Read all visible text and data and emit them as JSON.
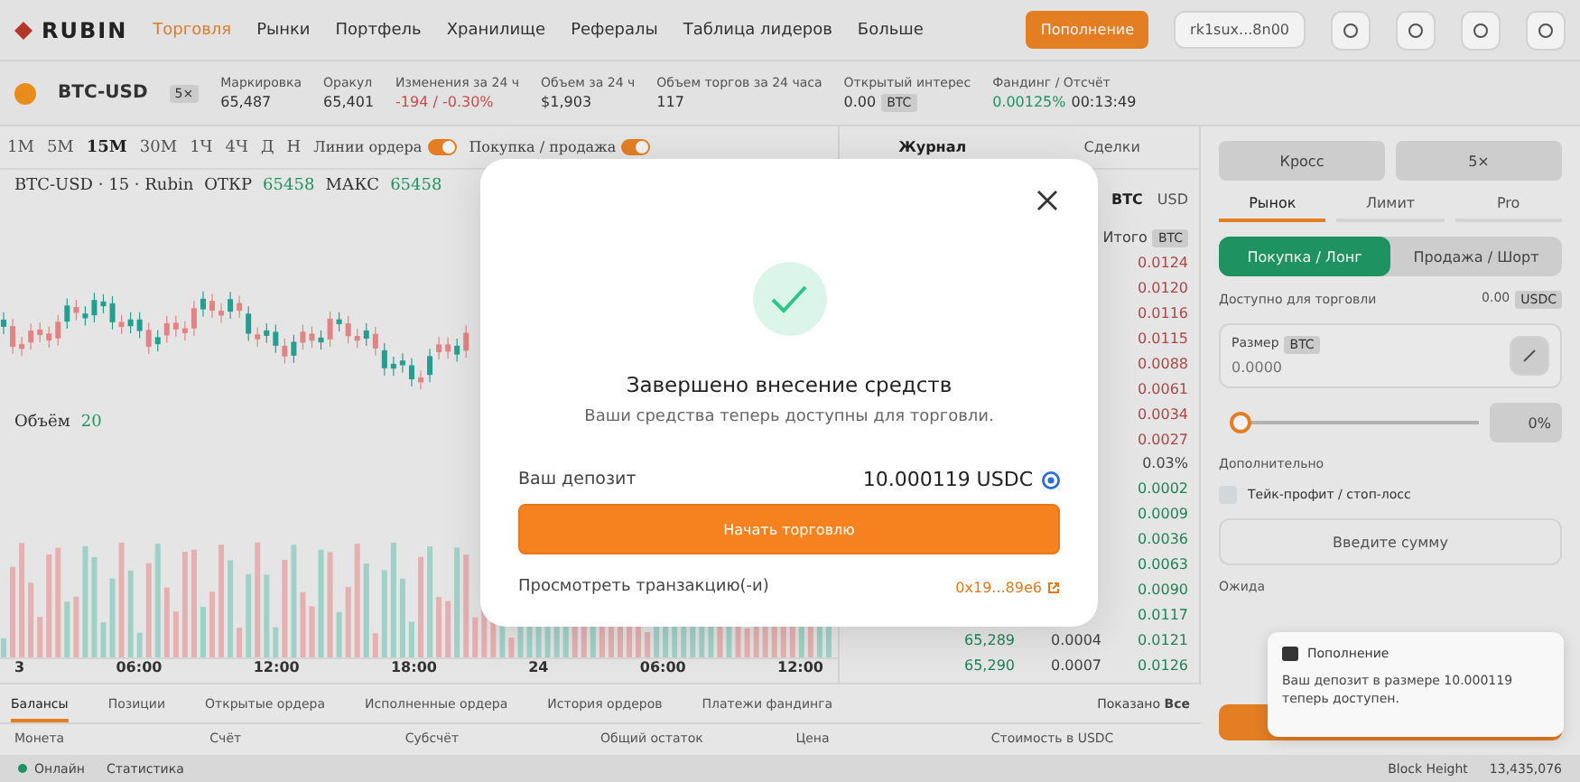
{
  "header": {
    "logo": "RUBIN",
    "nav": [
      {
        "label": "Торговля",
        "selected": true
      },
      {
        "label": "Рынки",
        "selected": false
      },
      {
        "label": "Портфель",
        "selected": false
      },
      {
        "label": "Хранилище",
        "selected": false
      },
      {
        "label": "Рефералы",
        "selected": false
      },
      {
        "label": "Таблица лидеров",
        "selected": false
      },
      {
        "label": "Больше",
        "selected": false
      }
    ],
    "deposit_button": "Пополнение",
    "wallet": "rk1sux...8n00"
  },
  "ticker": {
    "market": "BTC-USD",
    "leverage": "5×",
    "stats": [
      {
        "label": "Маркировка",
        "value": "65,487"
      },
      {
        "label": "Оракул",
        "value": "65,401"
      },
      {
        "label": "Изменения за 24 ч",
        "value": "-194 / -0.30%",
        "color": "#d84c4c"
      },
      {
        "label": "Объем за 24 ч",
        "value": "$1,903"
      },
      {
        "label": "Объем торгов за 24 часа",
        "value": "117"
      },
      {
        "label": "Открытый интерес",
        "value": "0.00",
        "unit": "BTC"
      },
      {
        "label": "Фандинг / Отсчёт",
        "value": "0.00125%",
        "color": "#1f9a66",
        "extra": "00:13:49"
      }
    ]
  },
  "chart": {
    "timeframes": [
      {
        "label": "1М",
        "selected": false
      },
      {
        "label": "5М",
        "selected": false
      },
      {
        "label": "15М",
        "selected": true
      },
      {
        "label": "30М",
        "selected": false
      },
      {
        "label": "1Ч",
        "selected": false
      },
      {
        "label": "4Ч",
        "selected": false
      },
      {
        "label": "Д",
        "selected": false
      },
      {
        "label": "Н",
        "selected": false
      }
    ],
    "toggles": [
      {
        "label": "Линии ордера",
        "on": true
      },
      {
        "label": "Покупка / продажа",
        "on": true
      }
    ],
    "legend": {
      "title": "BTC-USD · 15 · Rubin",
      "open_label": "ОТКР",
      "open": "65458",
      "high_label": "МАКС",
      "high": "65458"
    },
    "volume_label": "Объём",
    "volume": "20",
    "time_axis": [
      "3",
      "06:00",
      "12:00",
      "18:00",
      "24",
      "06:00",
      "12:00"
    ]
  },
  "orderbook": {
    "tabs": [
      {
        "label": "Журнал",
        "selected": true
      },
      {
        "label": "Сделки",
        "selected": false
      }
    ],
    "units": [
      {
        "label": "BTC",
        "selected": true
      },
      {
        "label": "USD",
        "selected": false
      }
    ],
    "total_label": "Итого",
    "total_unit": "BTC",
    "spread": "0.03%",
    "rows": [
      {
        "kind": "ask",
        "total": "0.0124"
      },
      {
        "kind": "ask",
        "total": "0.0120"
      },
      {
        "kind": "ask",
        "total": "0.0116"
      },
      {
        "kind": "ask",
        "total": "0.0115"
      },
      {
        "kind": "ask",
        "total": "0.0088"
      },
      {
        "kind": "ask",
        "total": "0.0061"
      },
      {
        "kind": "ask",
        "total": "0.0034"
      },
      {
        "kind": "ask",
        "total": "0.0027"
      },
      {
        "kind": "spread"
      },
      {
        "kind": "bid",
        "total": "0.0002"
      },
      {
        "kind": "bid",
        "total": "0.0009"
      },
      {
        "kind": "bid",
        "total": "0.0036"
      },
      {
        "kind": "bid",
        "total": "0.0063"
      },
      {
        "kind": "bid",
        "total": "0.0090"
      },
      {
        "kind": "bid",
        "total": "0.0117"
      },
      {
        "kind": "bid",
        "price": "65,289",
        "size": "0.0004",
        "total": "0.0121"
      },
      {
        "kind": "bid",
        "price": "65,290",
        "size": "0.0007",
        "total": "0.0126"
      }
    ]
  },
  "order_panel": {
    "margin": [
      "Кросс",
      "5×"
    ],
    "tabs": [
      {
        "label": "Рынок",
        "selected": true
      },
      {
        "label": "Лимит",
        "selected": false
      },
      {
        "label": "Pro",
        "selected": false
      }
    ],
    "sides": [
      {
        "label": "Покупка / Лонг",
        "selected": true
      },
      {
        "label": "Продажа / Шорт",
        "selected": false
      }
    ],
    "available_label": "Доступно для торговли",
    "available": "0.00",
    "available_unit": "USDC",
    "size_label": "Размер",
    "size_unit": "BTC",
    "size_placeholder": "0.0000",
    "slider": {
      "level": 0,
      "reading": "0%"
    },
    "extra_label": "Дополнительно",
    "tpsl": {
      "label": "Тейк-профит / стоп-лосс",
      "checked": false
    },
    "amount_placeholder": "Введите сумму",
    "pending_label": "Ожида"
  },
  "bottom": {
    "tabs": [
      {
        "label": "Балансы",
        "selected": true
      },
      {
        "label": "Позиции",
        "selected": false
      },
      {
        "label": "Открытые ордера",
        "selected": false
      },
      {
        "label": "Исполненные ордера",
        "selected": false
      },
      {
        "label": "История ордеров",
        "selected": false
      },
      {
        "label": "Платежи фандинга",
        "selected": false
      }
    ],
    "shown_label": "Показано",
    "shown_value": "Все",
    "columns": [
      "Монета",
      "Счёт",
      "Субсчёт",
      "Общий остаток",
      "Цена",
      "Стоимость в USDC"
    ]
  },
  "status_bar": {
    "online": "Онлайн",
    "stats": "Статистика",
    "block_label": "Block Height",
    "block": "13,435,076"
  },
  "modal": {
    "title": "Завершено внесение средств",
    "subtitle": "Ваши средства теперь доступны для торговли.",
    "deposit_label": "Ваш депозит",
    "deposit_amount": "10.000119 USDC",
    "button": "Начать торговлю",
    "tx_label": "Просмотреть транзакцию(-и)",
    "tx_hash": "0x19...89e6"
  },
  "toast": {
    "title": "Пополнение",
    "body": "Ваш депозит в размере 10.000119 теперь доступен."
  }
}
